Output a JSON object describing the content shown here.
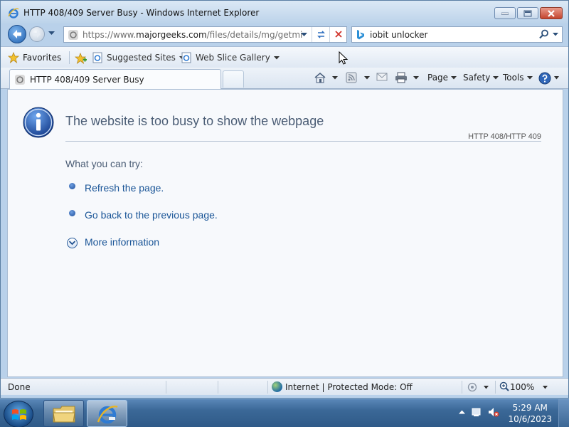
{
  "window": {
    "title": "HTTP 408/409 Server Busy - Windows Internet Explorer"
  },
  "navbar": {
    "address_gray_prefix": "https://www.",
    "address_domain": "majorgeeks.com",
    "address_gray_suffix": "/files/details/mg/getmirror",
    "search_query": "iobit unlocker"
  },
  "favorites_bar": {
    "favorites_label": "Favorites",
    "items": [
      {
        "label": "Suggested Sites",
        "icon": "ie-page-icon"
      },
      {
        "label": "Web Slice Gallery",
        "icon": "ie-page-icon"
      }
    ]
  },
  "tab": {
    "label": "HTTP 408/409 Server Busy"
  },
  "command_bar": {
    "page_label": "Page",
    "safety_label": "Safety",
    "tools_label": "Tools"
  },
  "content": {
    "heading": "The website is too busy to show the webpage",
    "error_code": "HTTP 408/HTTP 409",
    "try_label": "What you can try:",
    "suggestions": [
      "Refresh the page.",
      "Go back to the previous page."
    ],
    "more_info": "More information"
  },
  "status_bar": {
    "status": "Done",
    "zone": "Internet | Protected Mode: Off",
    "zoom": "100%"
  },
  "taskbar": {
    "time": "5:29 AM",
    "date": "10/6/2023"
  },
  "colors": {
    "heading": "#4b5d75",
    "link": "#1a5597",
    "close_button": "#c4452f"
  }
}
